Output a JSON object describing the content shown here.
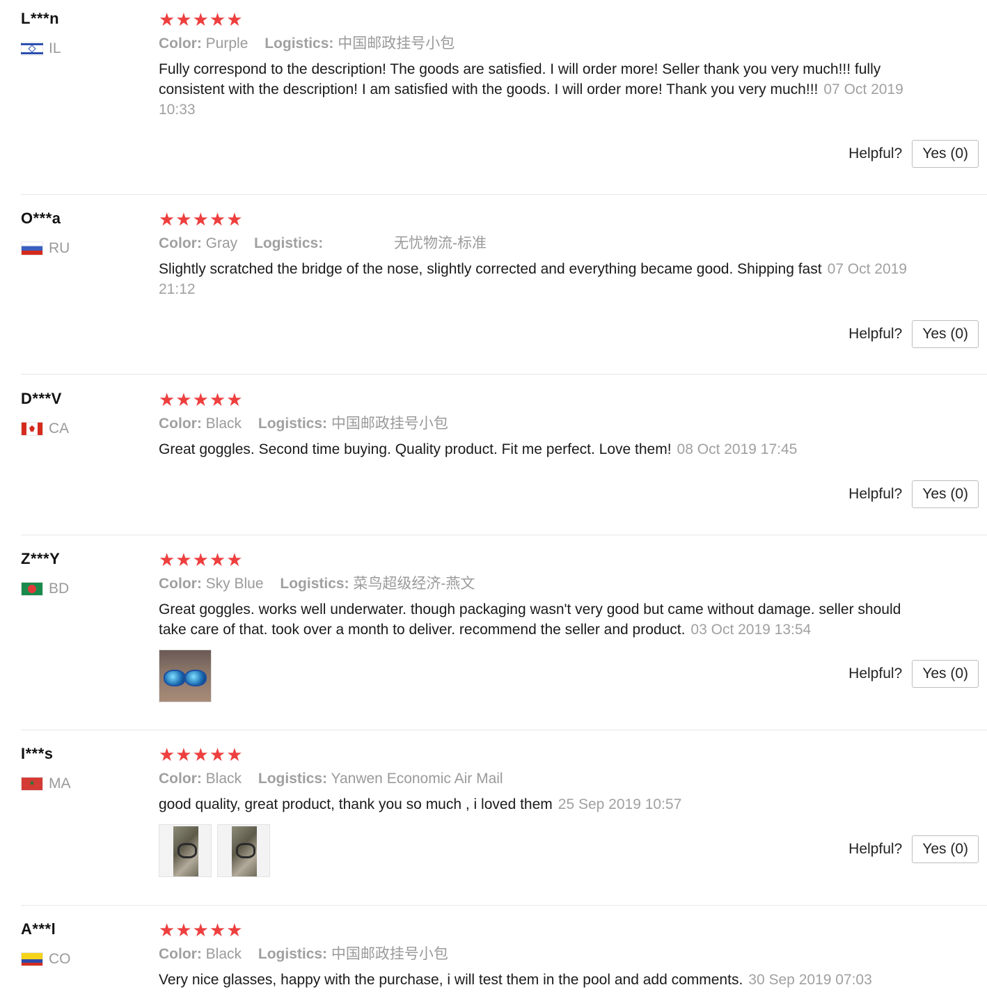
{
  "helpful_label": "Helpful?",
  "reviews": [
    {
      "user": "L***n",
      "country": "IL",
      "flag_icon": "israel-flag-icon",
      "stars": "★★★★★",
      "rating": 5,
      "color_label": "Color:",
      "color_value": "Purple",
      "logistics_label": "Logistics:",
      "logistics_value": "中国邮政挂号小包",
      "comment": "Fully correspond to the description! The goods are satisfied. I will order more! Seller thank you very much!!! fully consistent with the description! I am satisfied with the goods. I will order more! Thank you very much!!!",
      "date": "07 Oct 2019 10:33",
      "yes_label": "Yes (0)"
    },
    {
      "user": "O***a",
      "country": "RU",
      "flag_icon": "russia-flag-icon",
      "stars": "★★★★★",
      "rating": 5,
      "color_label": "Color:",
      "color_value": "Gray",
      "logistics_label": "Logistics:",
      "logistics_value": "无忧物流-标准",
      "comment": "Slightly scratched the bridge of the nose, slightly corrected and everything became good. Shipping fast",
      "date": "07 Oct 2019 21:12",
      "yes_label": "Yes (0)"
    },
    {
      "user": "D***V",
      "country": "CA",
      "flag_icon": "canada-flag-icon",
      "stars": "★★★★★",
      "rating": 5,
      "color_label": "Color:",
      "color_value": "Black",
      "logistics_label": "Logistics:",
      "logistics_value": "中国邮政挂号小包",
      "comment": "Great goggles. Second time buying. Quality product. Fit me perfect. Love them!",
      "date": "08 Oct 2019 17:45",
      "yes_label": "Yes (0)"
    },
    {
      "user": "Z***Y",
      "country": "BD",
      "flag_icon": "bangladesh-flag-icon",
      "stars": "★★★★★",
      "rating": 5,
      "color_label": "Color:",
      "color_value": "Sky Blue",
      "logistics_label": "Logistics:",
      "logistics_value": "菜鸟超级经济-燕文",
      "comment": "Great goggles. works well underwater. though packaging wasn't very good but came without damage. seller should take care of that. took over a month to deliver. recommend the seller and product.",
      "date": "03 Oct 2019 13:54",
      "yes_label": "Yes (0)"
    },
    {
      "user": "I***s",
      "country": "MA",
      "flag_icon": "morocco-flag-icon",
      "stars": "★★★★★",
      "rating": 5,
      "color_label": "Color:",
      "color_value": "Black",
      "logistics_label": "Logistics:",
      "logistics_value": "Yanwen Economic Air Mail",
      "comment": "good quality, great product, thank you so much , i loved them",
      "date": "25 Sep 2019 10:57",
      "yes_label": "Yes (0)"
    },
    {
      "user": "A***l",
      "country": "CO",
      "flag_icon": "colombia-flag-icon",
      "stars": "★★★★★",
      "rating": 5,
      "color_label": "Color:",
      "color_value": "Black",
      "logistics_label": "Logistics:",
      "logistics_value": "中国邮政挂号小包",
      "comment": "Very nice glasses, happy with the purchase, i will test them in the pool and add comments.",
      "date": "30 Sep 2019 07:03"
    }
  ],
  "colors": {
    "star": "#ee3f3f",
    "meta_gray": "#9a9a9a",
    "divider": "#e8e8e8"
  }
}
